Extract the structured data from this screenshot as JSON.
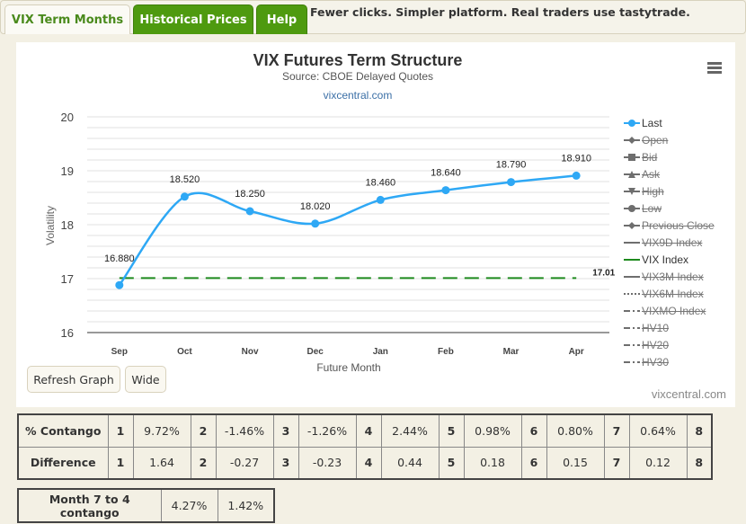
{
  "tabs": [
    {
      "label": "VIX Term Months",
      "active": true
    },
    {
      "label": "Historical Prices",
      "active": false
    },
    {
      "label": "Help",
      "active": false
    }
  ],
  "promo_text": "Fewer clicks. Simpler platform. Real traders use tastytrade.",
  "chart": {
    "menu_icon": "hamburger-menu-icon",
    "credit": "vixcentral.com",
    "buttons": {
      "refresh": "Refresh Graph",
      "wide": "Wide"
    }
  },
  "chart_data": {
    "type": "line",
    "title": "VIX Futures Term Structure",
    "subtitle": "Source: CBOE Delayed Quotes",
    "link_text": "vixcentral.com",
    "xlabel": "Future Month",
    "ylabel": "Volatility",
    "ylim": [
      16,
      20
    ],
    "yticks": [
      16,
      17,
      18,
      19,
      20
    ],
    "ytick_labels": [
      "16",
      "17",
      "18",
      "19",
      "20"
    ],
    "minor_grid_step": 0.2,
    "grid": true,
    "legend_position": "right",
    "categories": [
      "Sep",
      "Oct",
      "Nov",
      "Dec",
      "Jan",
      "Feb",
      "Mar",
      "Apr"
    ],
    "series": [
      {
        "name": "Last",
        "color": "#2ea8f5",
        "style": "spline",
        "values": [
          16.88,
          18.52,
          18.25,
          18.02,
          18.46,
          18.64,
          18.79,
          18.91
        ],
        "labels": [
          "16.880",
          "18.520",
          "18.250",
          "18.020",
          "18.460",
          "18.640",
          "18.790",
          "18.910"
        ]
      },
      {
        "name": "VIX Index",
        "color": "#1e8a1e",
        "style": "dashed",
        "values": [
          17.01,
          17.01,
          17.01,
          17.01,
          17.01,
          17.01,
          17.01,
          17.01
        ],
        "end_label": "17.01"
      }
    ],
    "legend": [
      {
        "name": "Last",
        "visible": true,
        "symbol": "circle",
        "color": "#2ea8f5"
      },
      {
        "name": "Open",
        "visible": false,
        "symbol": "diamond"
      },
      {
        "name": "Bid",
        "visible": false,
        "symbol": "square"
      },
      {
        "name": "Ask",
        "visible": false,
        "symbol": "triangle"
      },
      {
        "name": "High",
        "visible": false,
        "symbol": "triangle-down"
      },
      {
        "name": "Low",
        "visible": false,
        "symbol": "circle"
      },
      {
        "name": "Previous Close",
        "visible": false,
        "symbol": "diamond"
      },
      {
        "name": "VIX9D Index",
        "visible": false,
        "symbol": "line"
      },
      {
        "name": "VIX Index",
        "visible": true,
        "symbol": "line",
        "color": "#1e8a1e"
      },
      {
        "name": "VIX3M Index",
        "visible": false,
        "symbol": "line"
      },
      {
        "name": "VIX6M Index",
        "visible": false,
        "symbol": "dotted"
      },
      {
        "name": "VIXMO Index",
        "visible": false,
        "symbol": "dashdot"
      },
      {
        "name": "HV10",
        "visible": false,
        "symbol": "dashdot"
      },
      {
        "name": "HV20",
        "visible": false,
        "symbol": "dashdot"
      },
      {
        "name": "HV30",
        "visible": false,
        "symbol": "dashdot"
      }
    ]
  },
  "contango_table": {
    "rows": [
      {
        "label": "% Contango",
        "cells": [
          {
            "idx": "1",
            "val": "9.72%"
          },
          {
            "idx": "2",
            "val": "-1.46%"
          },
          {
            "idx": "3",
            "val": "-1.26%"
          },
          {
            "idx": "4",
            "val": "2.44%"
          },
          {
            "idx": "5",
            "val": "0.98%"
          },
          {
            "idx": "6",
            "val": "0.80%"
          },
          {
            "idx": "7",
            "val": "0.64%"
          },
          {
            "idx": "8",
            "val": ""
          }
        ]
      },
      {
        "label": "Difference",
        "cells": [
          {
            "idx": "1",
            "val": "1.64"
          },
          {
            "idx": "2",
            "val": "-0.27"
          },
          {
            "idx": "3",
            "val": "-0.23"
          },
          {
            "idx": "4",
            "val": "0.44"
          },
          {
            "idx": "5",
            "val": "0.18"
          },
          {
            "idx": "6",
            "val": "0.15"
          },
          {
            "idx": "7",
            "val": "0.12"
          },
          {
            "idx": "8",
            "val": ""
          }
        ]
      }
    ]
  },
  "month7to4": {
    "label": "Month 7 to 4 contango",
    "values": [
      "4.27%",
      "1.42%"
    ]
  }
}
